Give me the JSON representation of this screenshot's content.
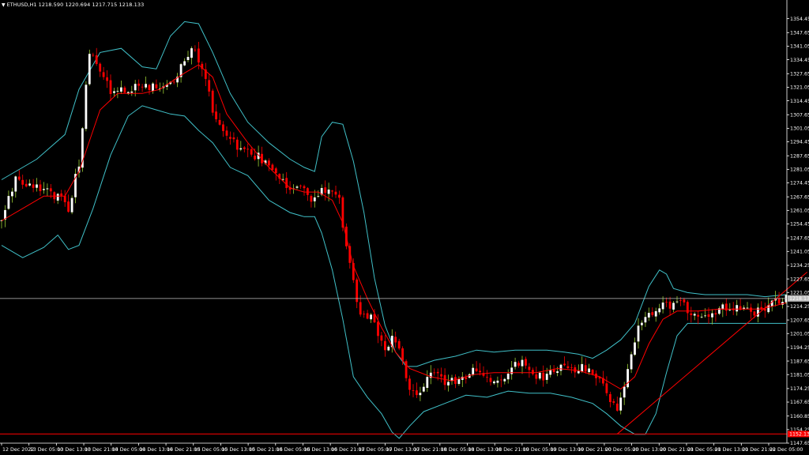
{
  "header": {
    "menu_arrow": "▼",
    "symbol": "ETHUSD,H1",
    "values": "1218.590 1220.694 1217.715 1218.133"
  },
  "colors": {
    "background": "#000000",
    "bull_candle": "#ffffff",
    "bull_wick": "#9acd32",
    "bear_candle": "#ff0000",
    "moving_average": "#ff0000",
    "bollinger_bands": "#40c0c8",
    "trendline": "#ff0000",
    "support_line": "#ff0000",
    "last_price_line": "#c0c0c0",
    "axis_text": "#ffffff"
  },
  "chart_data": {
    "type": "candlestick",
    "symbol": "ETHUSD",
    "timeframe": "H1",
    "ylim": [
      1147.65,
      1357.0
    ],
    "grid": false,
    "y_ticks": [
      "1354.450",
      "1347.650",
      "1341.050",
      "1334.450",
      "1327.650",
      "1321.050",
      "1314.450",
      "1307.650",
      "1301.050",
      "1294.450",
      "1287.650",
      "1281.050",
      "1274.450",
      "1267.650",
      "1261.050",
      "1254.450",
      "1247.650",
      "1241.050",
      "1234.250",
      "1227.650",
      "1221.050",
      "1214.250",
      "1207.650",
      "1201.050",
      "1194.250",
      "1187.650",
      "1181.050",
      "1174.250",
      "1167.650",
      "1160.850",
      "1154.250",
      "1147.650"
    ],
    "x_labels": [
      "12 Dec 2022",
      "13 Dec 05:00",
      "13 Dec 13:00",
      "13 Dec 21:00",
      "14 Dec 05:00",
      "14 Dec 13:00",
      "14 Dec 21:00",
      "15 Dec 05:00",
      "15 Dec 13:00",
      "15 Dec 21:00",
      "16 Dec 05:00",
      "16 Dec 13:00",
      "16 Dec 21:00",
      "17 Dec 05:00",
      "17 Dec 13:00",
      "17 Dec 21:00",
      "18 Dec 05:00",
      "18 Dec 13:00",
      "18 Dec 21:00",
      "19 Dec 05:00",
      "19 Dec 13:00",
      "19 Dec 21:00",
      "20 Dec 05:00",
      "20 Dec 13:00",
      "20 Dec 21:00",
      "21 Dec 05:00",
      "21 Dec 13:00",
      "21 Dec 21:00",
      "22 Dec 05:00"
    ],
    "current_price": "1218.133",
    "support_level_label": "1152.135",
    "support_level": 1152.1,
    "close_path": [
      [
        0,
        1256
      ],
      [
        4,
        1276
      ],
      [
        8,
        1274
      ],
      [
        12,
        1270
      ],
      [
        16,
        1268
      ],
      [
        19,
        1262
      ],
      [
        22,
        1284
      ],
      [
        24,
        1322
      ],
      [
        25,
        1338
      ],
      [
        28,
        1330
      ],
      [
        31,
        1318
      ],
      [
        35,
        1320
      ],
      [
        39,
        1322
      ],
      [
        43,
        1321
      ],
      [
        46,
        1320
      ],
      [
        49,
        1324
      ],
      [
        52,
        1334
      ],
      [
        55,
        1340
      ],
      [
        58,
        1326
      ],
      [
        60,
        1308
      ],
      [
        62,
        1302
      ],
      [
        65,
        1296
      ],
      [
        68,
        1290
      ],
      [
        72,
        1288
      ],
      [
        75,
        1285
      ],
      [
        79,
        1276
      ],
      [
        83,
        1270
      ],
      [
        86,
        1272
      ],
      [
        88,
        1266
      ],
      [
        91,
        1270
      ],
      [
        94,
        1271
      ],
      [
        96,
        1266
      ],
      [
        97,
        1252
      ],
      [
        99,
        1234
      ],
      [
        101,
        1216
      ],
      [
        103,
        1209
      ],
      [
        105,
        1212
      ],
      [
        107,
        1202
      ],
      [
        109,
        1193
      ],
      [
        111,
        1198
      ],
      [
        114,
        1190
      ],
      [
        116,
        1172
      ],
      [
        118,
        1170
      ],
      [
        121,
        1180
      ],
      [
        123,
        1181
      ],
      [
        126,
        1177
      ],
      [
        129,
        1178
      ],
      [
        132,
        1180
      ],
      [
        135,
        1184
      ],
      [
        138,
        1181
      ],
      [
        140,
        1178
      ],
      [
        143,
        1181
      ],
      [
        146,
        1185
      ],
      [
        149,
        1187
      ],
      [
        151,
        1180
      ],
      [
        154,
        1180
      ],
      [
        156,
        1181
      ],
      [
        159,
        1185
      ],
      [
        162,
        1183
      ],
      [
        165,
        1184
      ],
      [
        167,
        1182
      ],
      [
        169,
        1179
      ],
      [
        171,
        1177
      ],
      [
        173,
        1169
      ],
      [
        175,
        1164
      ],
      [
        177,
        1175
      ],
      [
        179,
        1190
      ],
      [
        181,
        1206
      ],
      [
        183,
        1211
      ],
      [
        186,
        1212
      ],
      [
        188,
        1218
      ],
      [
        190,
        1215
      ],
      [
        193,
        1215
      ],
      [
        196,
        1212
      ],
      [
        199,
        1211
      ],
      [
        202,
        1211
      ],
      [
        205,
        1214
      ],
      [
        208,
        1213
      ],
      [
        211,
        1214
      ],
      [
        214,
        1212
      ],
      [
        217,
        1213
      ],
      [
        220,
        1216
      ],
      [
        223,
        1218
      ]
    ],
    "bb_upper": [
      [
        0,
        1276
      ],
      [
        10,
        1286
      ],
      [
        18,
        1298
      ],
      [
        22,
        1320
      ],
      [
        28,
        1338
      ],
      [
        34,
        1340
      ],
      [
        40,
        1331
      ],
      [
        44,
        1330
      ],
      [
        48,
        1346
      ],
      [
        52,
        1353
      ],
      [
        56,
        1352
      ],
      [
        60,
        1338
      ],
      [
        65,
        1318
      ],
      [
        70,
        1304
      ],
      [
        76,
        1294
      ],
      [
        82,
        1286
      ],
      [
        86,
        1282
      ],
      [
        89,
        1280
      ],
      [
        91,
        1297
      ],
      [
        94,
        1304
      ],
      [
        97,
        1303
      ],
      [
        100,
        1285
      ],
      [
        103,
        1260
      ],
      [
        106,
        1228
      ],
      [
        109,
        1205
      ],
      [
        112,
        1192
      ],
      [
        115,
        1185
      ],
      [
        118,
        1185
      ],
      [
        123,
        1188
      ],
      [
        129,
        1190
      ],
      [
        135,
        1193
      ],
      [
        140,
        1192
      ],
      [
        146,
        1193
      ],
      [
        151,
        1193
      ],
      [
        155,
        1193
      ],
      [
        160,
        1192
      ],
      [
        164,
        1191
      ],
      [
        168,
        1189
      ],
      [
        172,
        1193
      ],
      [
        176,
        1198
      ],
      [
        180,
        1206
      ],
      [
        184,
        1224
      ],
      [
        187,
        1232
      ],
      [
        189,
        1230
      ],
      [
        191,
        1223
      ],
      [
        195,
        1221
      ],
      [
        200,
        1220
      ],
      [
        206,
        1220
      ],
      [
        212,
        1220
      ],
      [
        217,
        1219
      ],
      [
        223,
        1220
      ]
    ],
    "bb_lower": [
      [
        0,
        1244
      ],
      [
        6,
        1238
      ],
      [
        12,
        1243
      ],
      [
        16,
        1249
      ],
      [
        19,
        1242
      ],
      [
        22,
        1244
      ],
      [
        26,
        1262
      ],
      [
        31,
        1288
      ],
      [
        36,
        1307
      ],
      [
        40,
        1312
      ],
      [
        44,
        1310
      ],
      [
        48,
        1308
      ],
      [
        52,
        1307
      ],
      [
        56,
        1300
      ],
      [
        60,
        1294
      ],
      [
        65,
        1282
      ],
      [
        70,
        1278
      ],
      [
        76,
        1266
      ],
      [
        82,
        1260
      ],
      [
        86,
        1258
      ],
      [
        89,
        1258
      ],
      [
        91,
        1250
      ],
      [
        94,
        1232
      ],
      [
        97,
        1208
      ],
      [
        100,
        1180
      ],
      [
        104,
        1170
      ],
      [
        108,
        1162
      ],
      [
        111,
        1153
      ],
      [
        113,
        1150
      ],
      [
        116,
        1156
      ],
      [
        120,
        1163
      ],
      [
        126,
        1167
      ],
      [
        132,
        1171
      ],
      [
        138,
        1170
      ],
      [
        144,
        1173
      ],
      [
        150,
        1172
      ],
      [
        156,
        1172
      ],
      [
        162,
        1170
      ],
      [
        168,
        1167
      ],
      [
        172,
        1162
      ],
      [
        176,
        1156
      ],
      [
        180,
        1152
      ],
      [
        183,
        1152
      ],
      [
        186,
        1162
      ],
      [
        189,
        1182
      ],
      [
        192,
        1200
      ],
      [
        195,
        1206
      ],
      [
        200,
        1206
      ],
      [
        206,
        1206
      ],
      [
        212,
        1206
      ],
      [
        217,
        1206
      ],
      [
        223,
        1206
      ]
    ],
    "ma": [
      [
        0,
        1256
      ],
      [
        6,
        1262
      ],
      [
        12,
        1268
      ],
      [
        18,
        1268
      ],
      [
        22,
        1280
      ],
      [
        28,
        1310
      ],
      [
        33,
        1318
      ],
      [
        40,
        1318
      ],
      [
        45,
        1320
      ],
      [
        52,
        1328
      ],
      [
        56,
        1332
      ],
      [
        60,
        1326
      ],
      [
        64,
        1308
      ],
      [
        70,
        1294
      ],
      [
        76,
        1282
      ],
      [
        82,
        1272
      ],
      [
        86,
        1270
      ],
      [
        90,
        1270
      ],
      [
        94,
        1266
      ],
      [
        97,
        1255
      ],
      [
        100,
        1234
      ],
      [
        104,
        1218
      ],
      [
        108,
        1204
      ],
      [
        112,
        1192
      ],
      [
        116,
        1184
      ],
      [
        122,
        1180
      ],
      [
        128,
        1178
      ],
      [
        134,
        1181
      ],
      [
        140,
        1182
      ],
      [
        146,
        1182
      ],
      [
        152,
        1182
      ],
      [
        158,
        1184
      ],
      [
        164,
        1183
      ],
      [
        170,
        1180
      ],
      [
        176,
        1174
      ],
      [
        180,
        1180
      ],
      [
        184,
        1196
      ],
      [
        188,
        1208
      ],
      [
        192,
        1212
      ],
      [
        198,
        1212
      ],
      [
        204,
        1213
      ],
      [
        210,
        1213
      ],
      [
        216,
        1213
      ],
      [
        223,
        1216
      ]
    ],
    "trendline": [
      [
        175,
        1152.1
      ],
      [
        229,
        1231.0
      ]
    ]
  }
}
